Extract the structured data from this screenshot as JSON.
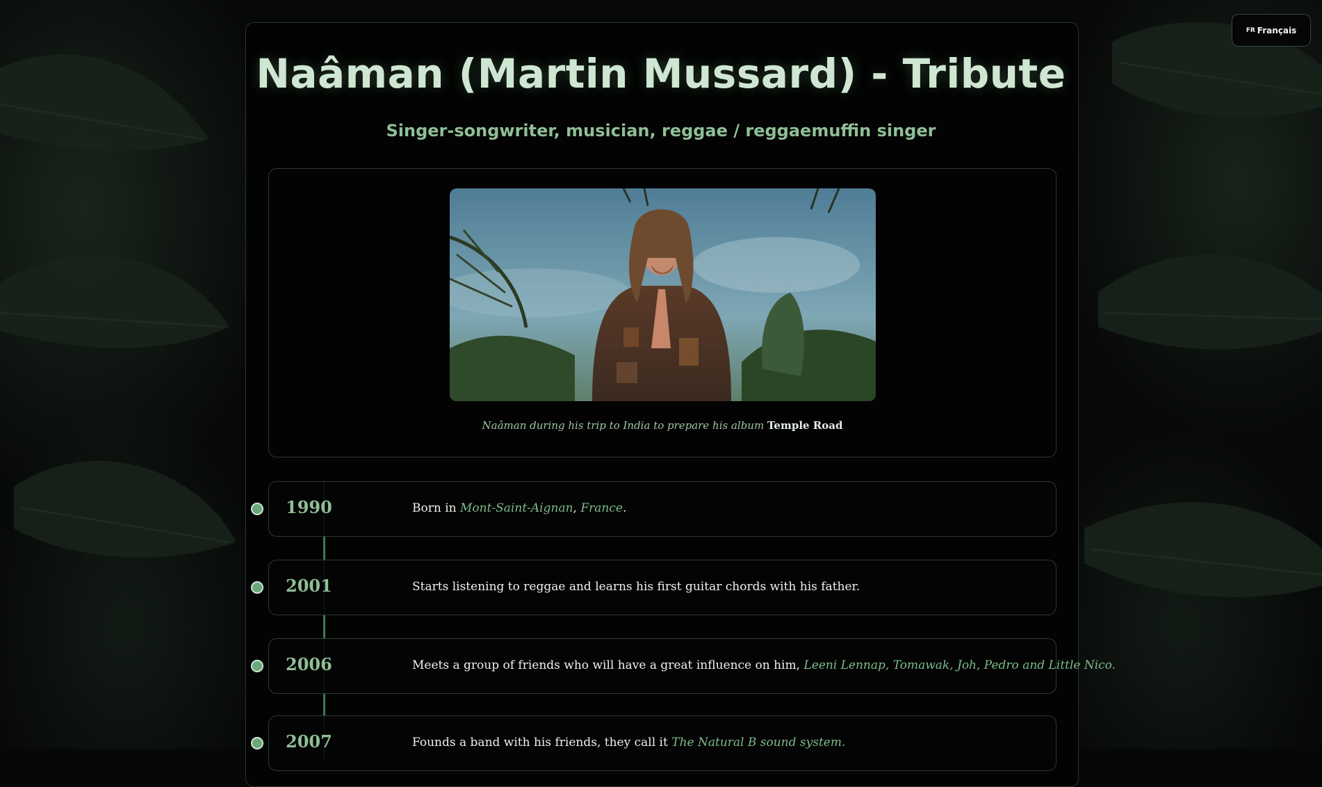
{
  "language_button": {
    "flag": "FR",
    "label": "Français"
  },
  "header": {
    "title": "Naâman (Martin Mussard) - Tribute",
    "subtitle": "Singer-songwriter, musician, reggae / reggaemuffin singer"
  },
  "photo": {
    "caption_prefix": "Naâman during his trip to India to prepare his album",
    "caption_album": "Temple Road"
  },
  "timeline": [
    {
      "year": "1990",
      "text_before": "Born in ",
      "accent_1": "Mont-Saint-Aignan",
      "separator": ", ",
      "accent_2": "France",
      "text_after": "."
    },
    {
      "year": "2001",
      "text": "Starts listening to reggae and learns his first guitar chords with his father."
    },
    {
      "year": "2006",
      "text_before": "Meets a group of friends who will have a great influence on him, ",
      "accent": "Leeni Lennap, Tomawak, Joh, Pedro and Little Nico."
    },
    {
      "year": "2007",
      "text_before": "Founds a band with his friends, they call it ",
      "accent": "The Natural B sound system."
    }
  ],
  "colors": {
    "accent": "#8fbf96",
    "timeline_line": "#3f7a55",
    "background": "#060807"
  }
}
